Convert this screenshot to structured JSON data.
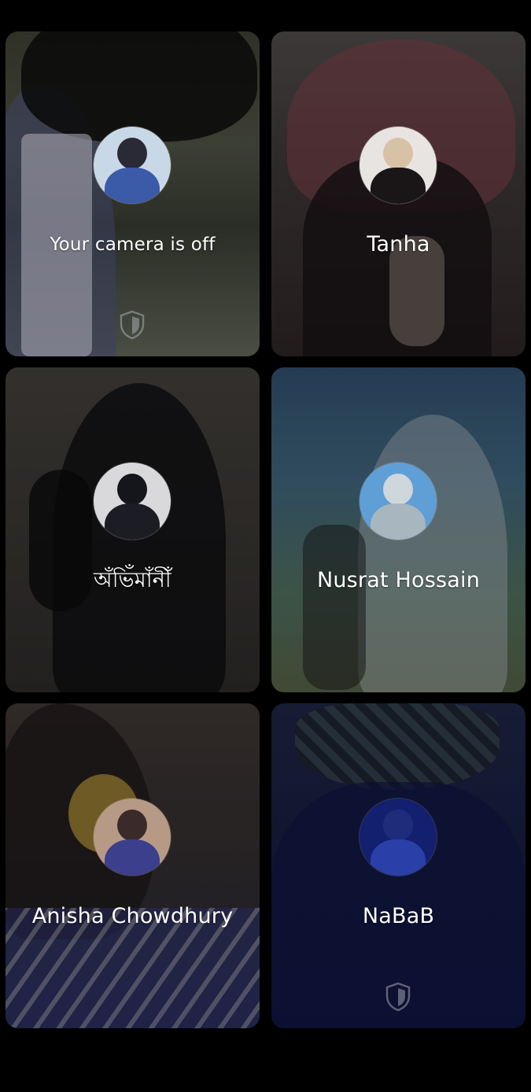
{
  "participants": [
    {
      "name": "Your camera is off",
      "is_self": true,
      "avatar_colors": {
        "head": "#2a2a36",
        "body": "#3b5aa8",
        "bg": "#c9d8e6"
      }
    },
    {
      "name": "Tanha",
      "avatar_colors": {
        "head": "#d8c2a6",
        "body": "#1a1618",
        "bg": "#e8e4e2"
      }
    },
    {
      "name": "অঁভিঁমাঁনীঁ",
      "avatar_colors": {
        "head": "#15161c",
        "body": "#1c1d24",
        "bg": "#d9d9dc"
      }
    },
    {
      "name": "Nusrat Hossain",
      "avatar_colors": {
        "head": "#cfd6dc",
        "body": "#a8b6bf",
        "bg": "#5f9fd6"
      }
    },
    {
      "name": "Anisha Chowdhury",
      "avatar_colors": {
        "head": "#3a2a2a",
        "body": "#3b3f8c",
        "bg": "#b79a86"
      }
    },
    {
      "name": "NaBaB",
      "avatar_colors": {
        "head": "#1f2c7a",
        "body": "#2a3fa8",
        "bg": "#132070"
      }
    }
  ],
  "icons": {
    "privacy_shield": "shield-icon"
  },
  "colors": {
    "background": "#000000",
    "text": "#ffffff"
  }
}
